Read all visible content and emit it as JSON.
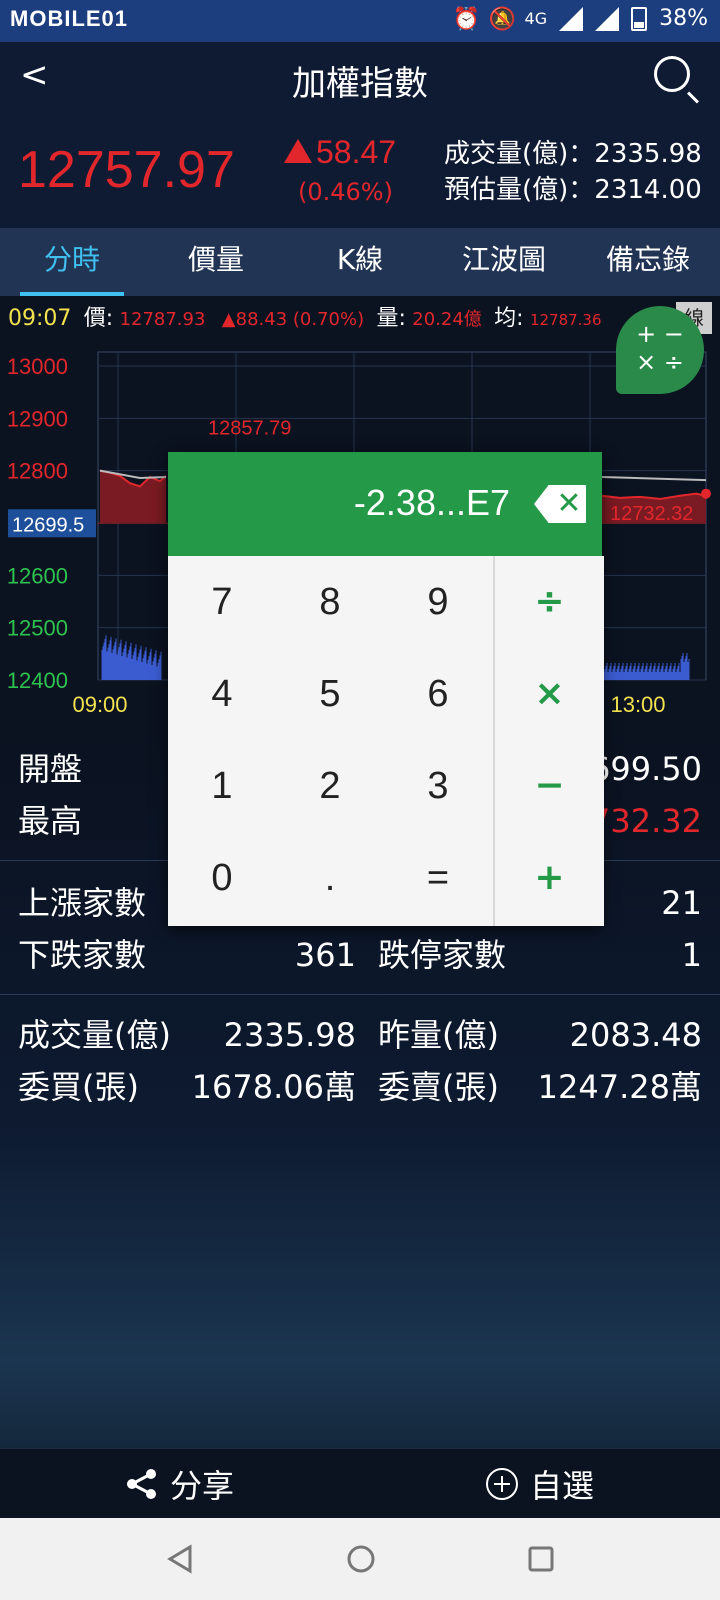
{
  "status_bar": {
    "brand": "MOBILE01",
    "battery": "38%",
    "network": "4G"
  },
  "app_bar": {
    "title": "加權指數"
  },
  "quote": {
    "price": "12757.97",
    "change": "58.47",
    "change_pct": "(0.46%)",
    "vol_label": "成交量(億)：2335.98",
    "est_label": "預估量(億)：2314.00"
  },
  "tabs": [
    "分時",
    "價量",
    "K線",
    "江波圖",
    "備忘錄"
  ],
  "info_line": {
    "time": "09:07",
    "price_label": "價:",
    "price": "12787.93",
    "change": "▲88.43 (0.70%)",
    "vol_label": "量:",
    "vol": "20.24億",
    "avg_label": "均:",
    "avg": "12787.36",
    "tag": "線"
  },
  "chart_data": {
    "type": "line",
    "ylim": [
      12400,
      13000
    ],
    "y_ticks": [
      "13000",
      "12900",
      "12800",
      "12700",
      "12600",
      "12500",
      "12400"
    ],
    "x_ticks": [
      "09:00",
      "13:00"
    ],
    "reference": "12699.5",
    "high_label": "12857.79",
    "last_label": "12732.32"
  },
  "fab": {
    "line1": "+ −",
    "line2": "× ÷"
  },
  "calculator": {
    "display": "-2.38...E7",
    "keys": [
      "7",
      "8",
      "9",
      "4",
      "5",
      "6",
      "1",
      "2",
      "3",
      "0",
      ".",
      "="
    ],
    "ops": [
      "÷",
      "×",
      "−",
      "+"
    ]
  },
  "stats": {
    "open_label": "開盤",
    "open_value": "699.50",
    "high_label": "最高",
    "high_value": "732.32",
    "up_label": "上漲家數",
    "up_value": "21",
    "down_label": "下跌家數",
    "down_value": "361",
    "limitdown_label": "跌停家數",
    "limitdown_value": "1",
    "vol_label": "成交量(億)",
    "vol_value": "2335.98",
    "prevvol_label": "昨量(億)",
    "prevvol_value": "2083.48",
    "bid_label": "委買(張)",
    "bid_value": "1678.06萬",
    "ask_label": "委賣(張)",
    "ask_value": "1247.28萬"
  },
  "bottom_bar": {
    "share": "分享",
    "favorite": "自選"
  }
}
